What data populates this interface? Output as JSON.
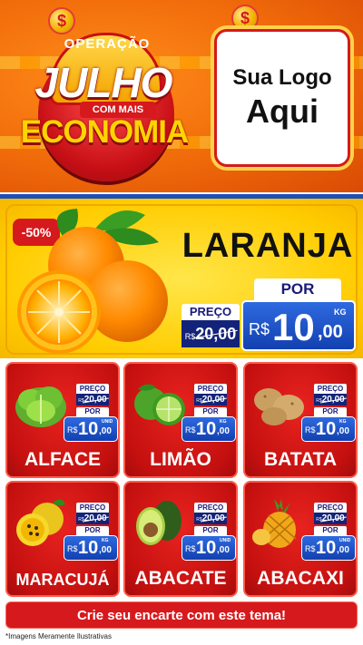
{
  "header": {
    "emblem_top": "OPERAÇÃO",
    "emblem_main": "JULHO",
    "emblem_sub": "COM MAIS",
    "emblem_word": "ECONOMIA",
    "coin_symbol": "$",
    "logo_line1": "Sua Logo",
    "logo_line2": "Aqui"
  },
  "featured": {
    "discount": "-50%",
    "name": "LARANJA",
    "old_label": "PREÇO",
    "old_currency": "R$",
    "old_price": "20,00",
    "new_label": "POR",
    "new_currency": "R$",
    "new_int": "10",
    "new_dec": ",00",
    "unit": "KG"
  },
  "products": [
    {
      "name": "ALFACE",
      "old_label": "PREÇO",
      "old_currency": "R$",
      "old_price": "20,00",
      "new_label": "POR",
      "new_currency": "R$",
      "new_int": "10",
      "new_dec": ",00",
      "unit": "UNID",
      "icon": "lettuce-icon"
    },
    {
      "name": "LIMÃO",
      "old_label": "PREÇO",
      "old_currency": "R$",
      "old_price": "20,00",
      "new_label": "POR",
      "new_currency": "R$",
      "new_int": "10",
      "new_dec": ",00",
      "unit": "KG",
      "icon": "lime-icon"
    },
    {
      "name": "BATATA",
      "old_label": "PREÇO",
      "old_currency": "R$",
      "old_price": "20,00",
      "new_label": "POR",
      "new_currency": "R$",
      "new_int": "10",
      "new_dec": ",00",
      "unit": "KG",
      "icon": "potato-icon"
    },
    {
      "name": "MARACUJÁ",
      "old_label": "PREÇO",
      "old_currency": "R$",
      "old_price": "20,00",
      "new_label": "POR",
      "new_currency": "R$",
      "new_int": "10",
      "new_dec": ",00",
      "unit": "KG",
      "icon": "passion-fruit-icon"
    },
    {
      "name": "ABACATE",
      "old_label": "PREÇO",
      "old_currency": "R$",
      "old_price": "20,00",
      "new_label": "POR",
      "new_currency": "R$",
      "new_int": "10",
      "new_dec": ",00",
      "unit": "UNID",
      "icon": "avocado-icon"
    },
    {
      "name": "ABACAXI",
      "old_label": "PREÇO",
      "old_currency": "R$",
      "old_price": "20,00",
      "new_label": "POR",
      "new_currency": "R$",
      "new_int": "10",
      "new_dec": ",00",
      "unit": "UNID",
      "icon": "pineapple-icon"
    }
  ],
  "footer": {
    "cta": "Crie seu encarte com este tema!",
    "disclaimer": "*Imagens Meramente Ilustrativas"
  },
  "colors": {
    "header_orange": "#f06a0a",
    "brand_red": "#d6191d",
    "price_blue": "#1d4fb8",
    "feature_yellow": "#ffcc00"
  }
}
